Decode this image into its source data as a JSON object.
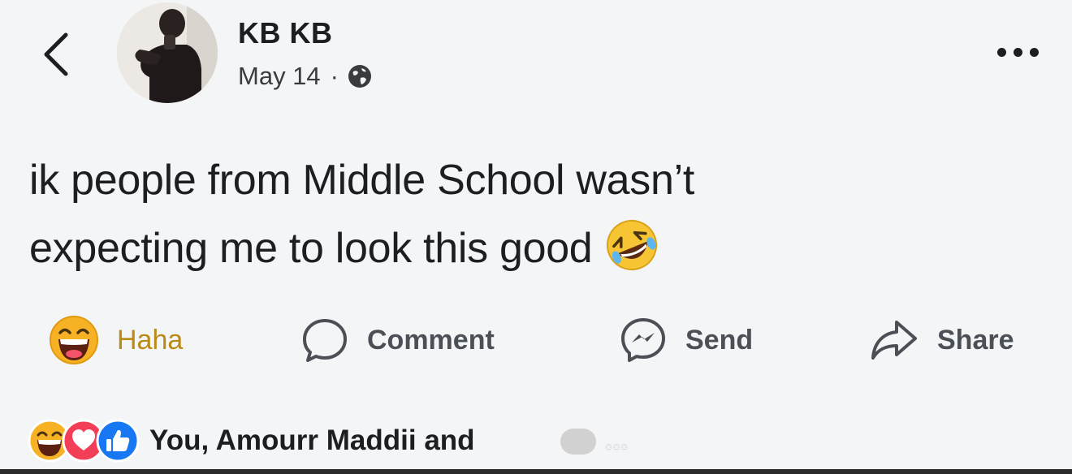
{
  "header": {
    "author_name": "KB KB",
    "date": "May 14",
    "separator": "·",
    "privacy_icon": "globe-icon",
    "back_icon": "chevron-left-icon",
    "more_icon": "more-horizontal-icon"
  },
  "post": {
    "text_line_1": "ik people from Middle School wasn’t",
    "text_line_2": "expecting me to look this good",
    "emoji": "rolling-on-floor-laughing-emoji"
  },
  "actions": {
    "haha_label": "Haha",
    "comment_label": "Comment",
    "send_label": "Send",
    "share_label": "Share",
    "haha_color": "#b98a18"
  },
  "reactions": {
    "summary": "You, Amourr Maddii and",
    "icons": [
      "haha-reaction-icon",
      "love-reaction-icon",
      "like-reaction-icon"
    ],
    "watermark": "…"
  },
  "colors": {
    "text": "#1c1e21",
    "background": "#f4f5f6",
    "like_blue": "#1877f2",
    "love_red": "#f33e58",
    "haha_yellow": "#f7b125"
  }
}
